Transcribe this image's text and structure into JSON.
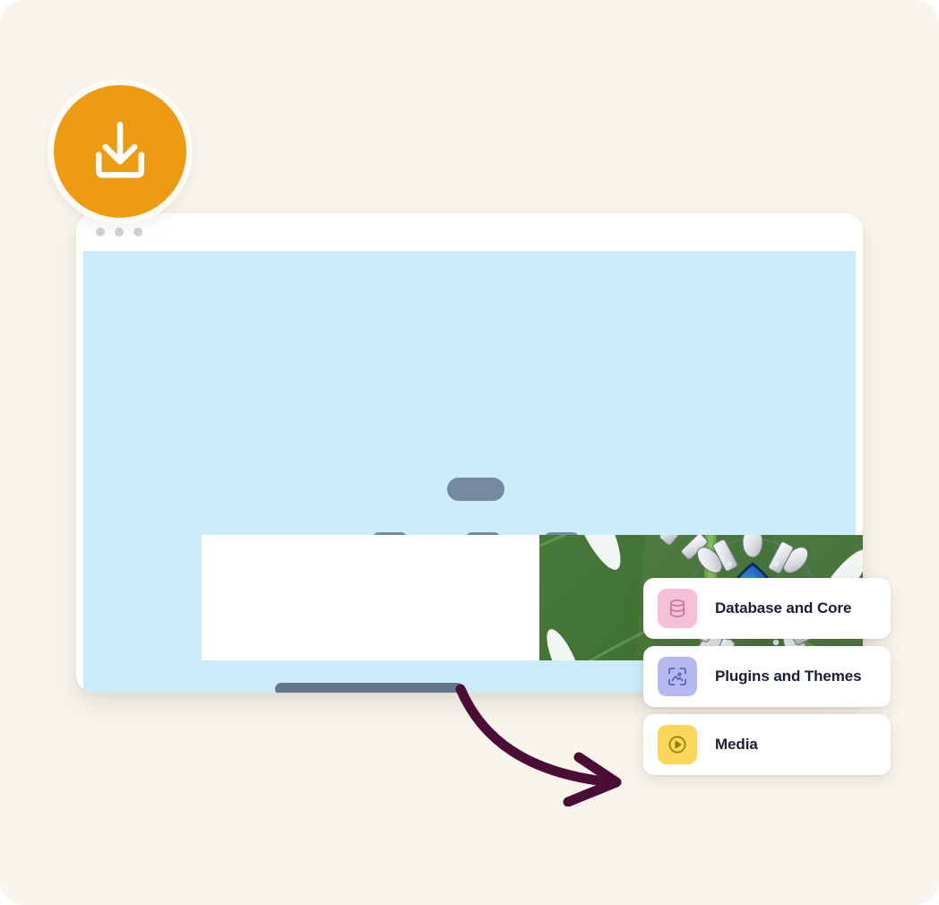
{
  "canvas": {
    "background_color": "#F9F5EE"
  },
  "download_badge": {
    "icon": "download-tray-icon",
    "color": "#ED9B10",
    "ring_color": "#FCFBF7"
  },
  "browser_window": {
    "title_bar": {
      "dots": [
        "window-dot",
        "window-dot",
        "window-dot"
      ],
      "dot_color": "#D3D3D4"
    },
    "viewport": {
      "background_color": "#CCEBFB",
      "hero_placeholders": {
        "heading_pill": "",
        "nav_pills": [
          "",
          "",
          ""
        ],
        "pill_color": "#748AA3"
      },
      "content_card": {
        "text_placeholders": [
          "",
          "",
          ""
        ],
        "cta_placeholder": "",
        "bar_color": "#64748B",
        "photo": {
          "alt": "crystal and sapphire earrings on a green monstera leaf",
          "leaf_color": "#4B7C3F",
          "gem_color": "#1552A3"
        }
      }
    }
  },
  "arrow_annotation": {
    "name": "curved-arrow",
    "color": "#4A0D33"
  },
  "categories": [
    {
      "label": "Database and Core",
      "icon": "database-icon",
      "icon_bg": "#F3C0D5",
      "icon_fg": "#C2789D"
    },
    {
      "label": "Plugins and Themes",
      "icon": "image-frame-icon",
      "icon_bg": "#B5B8EE",
      "icon_fg": "#5C61B8"
    },
    {
      "label": "Media",
      "icon": "play-circle-icon",
      "icon_bg": "#F7D košice",
      "icon_fg": "#9A7A14"
    }
  ]
}
